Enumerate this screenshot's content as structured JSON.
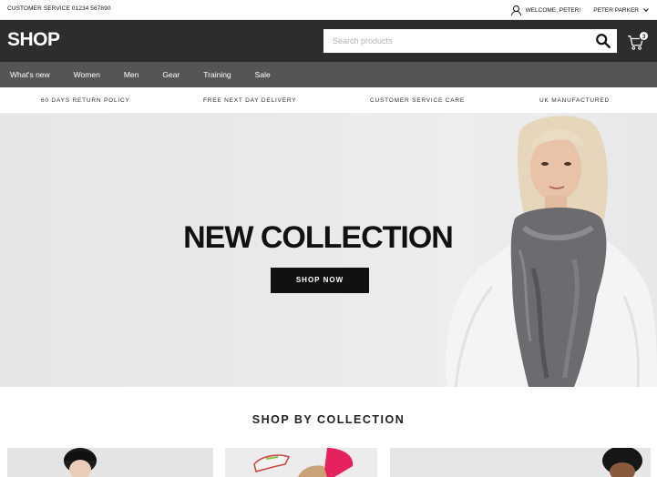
{
  "topbar": {
    "customer_service": "CUSTOMER SERVICE 01234 567890",
    "welcome": "WELCOME, PETER!",
    "account_name": "PETER PARKER"
  },
  "header": {
    "logo": "SHOP",
    "search_placeholder": "Search products",
    "cart_count": "3"
  },
  "nav": {
    "items": [
      "What's new",
      "Women",
      "Men",
      "Gear",
      "Training",
      "Sale"
    ]
  },
  "usp": {
    "items": [
      "60 DAYS RETURN POLICY",
      "FREE NEXT DAY DELIVERY",
      "CUSTOMER SERVICE CARE",
      "UK MANUFACTURED"
    ]
  },
  "hero": {
    "title": "NEW COLLECTION",
    "button": "SHOP NOW"
  },
  "collection": {
    "title": "SHOP BY COLLECTION"
  },
  "colors": {
    "header_bg": "#2d2d2d",
    "nav_bg": "#555555",
    "hero_bg": "#e9e9e9",
    "button_bg": "#111111"
  }
}
